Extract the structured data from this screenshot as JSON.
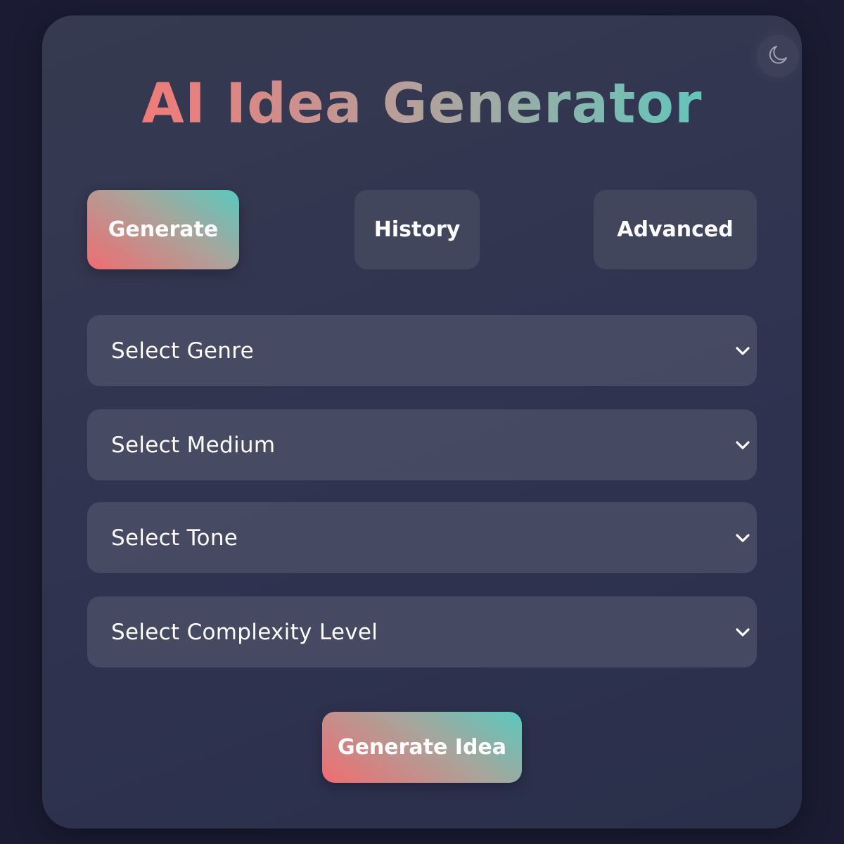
{
  "app": {
    "title": "AI Idea Generator"
  },
  "tabs": [
    {
      "label": "Generate",
      "active": true
    },
    {
      "label": "History",
      "active": false
    },
    {
      "label": "Advanced",
      "active": false
    }
  ],
  "selects": {
    "genre": {
      "selected": "Select Genre"
    },
    "medium": {
      "selected": "Select Medium"
    },
    "tone": {
      "selected": "Select Tone"
    },
    "complexity": {
      "selected": "Select Complexity Level"
    }
  },
  "actions": {
    "generate_idea_label": "Generate Idea"
  },
  "icons": {
    "theme_toggle": "moon-icon",
    "select_arrow": "chevron-down-icon"
  },
  "colors": {
    "page_background": "#1b1c34",
    "card_background": "#32364f",
    "accent_start": "#f06c70",
    "accent_end": "#5ac9bd",
    "inactive_tab": "#42465c",
    "text": "#ffffff"
  }
}
